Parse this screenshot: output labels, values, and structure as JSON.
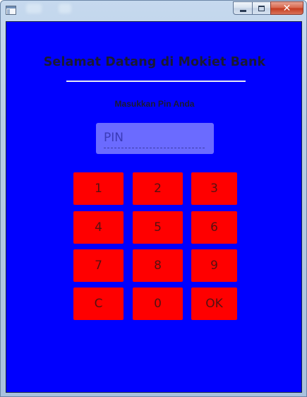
{
  "window": {
    "title": "",
    "icons": {
      "app": "app-window-icon",
      "minimize": "minimize-icon",
      "maximize": "maximize-icon",
      "close": "close-icon"
    },
    "close_glyph": "✕"
  },
  "main": {
    "heading": "Selamat Datang di Mokiet Bank",
    "prompt": "Masukkan Pin Anda",
    "pin_input": {
      "value": "",
      "placeholder": "PIN"
    }
  },
  "keypad": {
    "keys": [
      "1",
      "2",
      "3",
      "4",
      "5",
      "6",
      "7",
      "8",
      "9",
      "C",
      "0",
      "OK"
    ]
  },
  "colors": {
    "background": "#0000ff",
    "key_background": "#ff0000",
    "pin_box": "#6b6bff",
    "text_dark": "#1a1a33"
  }
}
